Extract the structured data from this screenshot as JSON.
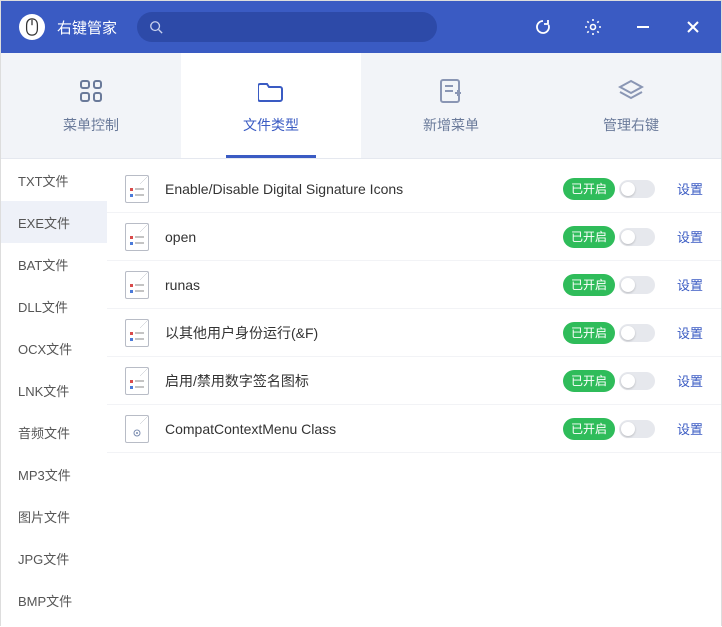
{
  "app": {
    "title": "右键管家"
  },
  "search": {
    "placeholder": ""
  },
  "tabs": [
    {
      "id": "menu-control",
      "label": "菜单控制",
      "active": false
    },
    {
      "id": "file-types",
      "label": "文件类型",
      "active": true
    },
    {
      "id": "add-menu",
      "label": "新增菜单",
      "active": false
    },
    {
      "id": "manage-rc",
      "label": "管理右键",
      "active": false
    }
  ],
  "sidebar": {
    "items": [
      {
        "label": "TXT文件",
        "active": false
      },
      {
        "label": "EXE文件",
        "active": true
      },
      {
        "label": "BAT文件",
        "active": false
      },
      {
        "label": "DLL文件",
        "active": false
      },
      {
        "label": "OCX文件",
        "active": false
      },
      {
        "label": "LNK文件",
        "active": false
      },
      {
        "label": "音频文件",
        "active": false
      },
      {
        "label": "MP3文件",
        "active": false
      },
      {
        "label": "图片文件",
        "active": false
      },
      {
        "label": "JPG文件",
        "active": false
      },
      {
        "label": "BMP文件",
        "active": false
      }
    ]
  },
  "list": {
    "status_label": "已开启",
    "config_label": "设置",
    "items": [
      {
        "name": "Enable/Disable Digital Signature Icons",
        "icon": "props"
      },
      {
        "name": "open",
        "icon": "props"
      },
      {
        "name": "runas",
        "icon": "props"
      },
      {
        "name": "以其他用户身份运行(&F)",
        "icon": "props"
      },
      {
        "name": "启用/禁用数字签名图标",
        "icon": "props"
      },
      {
        "name": "CompatContextMenu Class",
        "icon": "gear"
      }
    ]
  }
}
